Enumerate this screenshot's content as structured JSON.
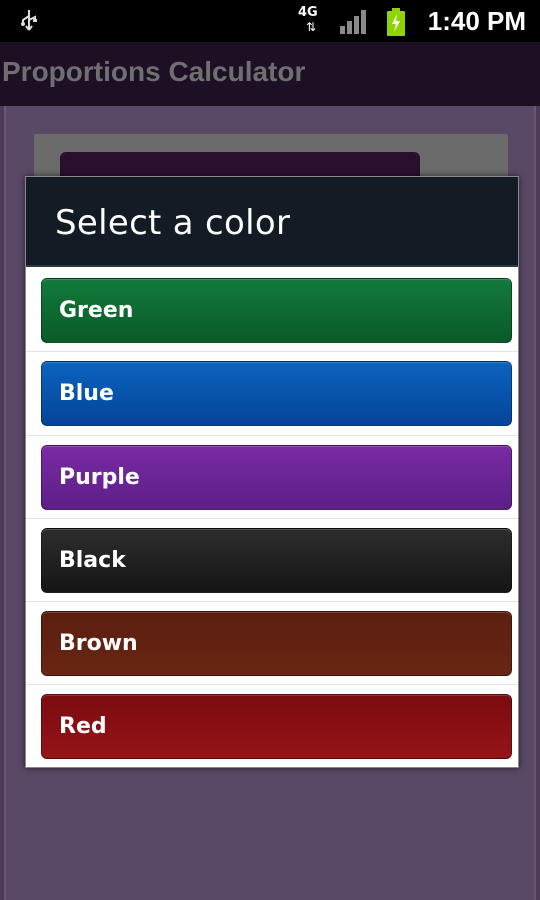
{
  "status_bar": {
    "network": "4G",
    "time": "1:40 PM",
    "icons": [
      "usb-icon",
      "data-arrows-icon",
      "signal-icon",
      "battery-charging-icon"
    ]
  },
  "app": {
    "title": "Proportions Calculator"
  },
  "dialog": {
    "title": "Select a color",
    "options": [
      {
        "label": "Green",
        "color": "#0e6b33"
      },
      {
        "label": "Blue",
        "color": "#0756ad"
      },
      {
        "label": "Purple",
        "color": "#6b2496"
      },
      {
        "label": "Black",
        "color": "#1f1f1f"
      },
      {
        "label": "Brown",
        "color": "#612211"
      },
      {
        "label": "Red",
        "color": "#8a1015"
      }
    ]
  },
  "colors": {
    "status_bar_bg": "#000000",
    "title_bar_bg": "#1d0f24",
    "dialog_header_bg": "#131b24",
    "dim_background": "#4b3b56"
  }
}
